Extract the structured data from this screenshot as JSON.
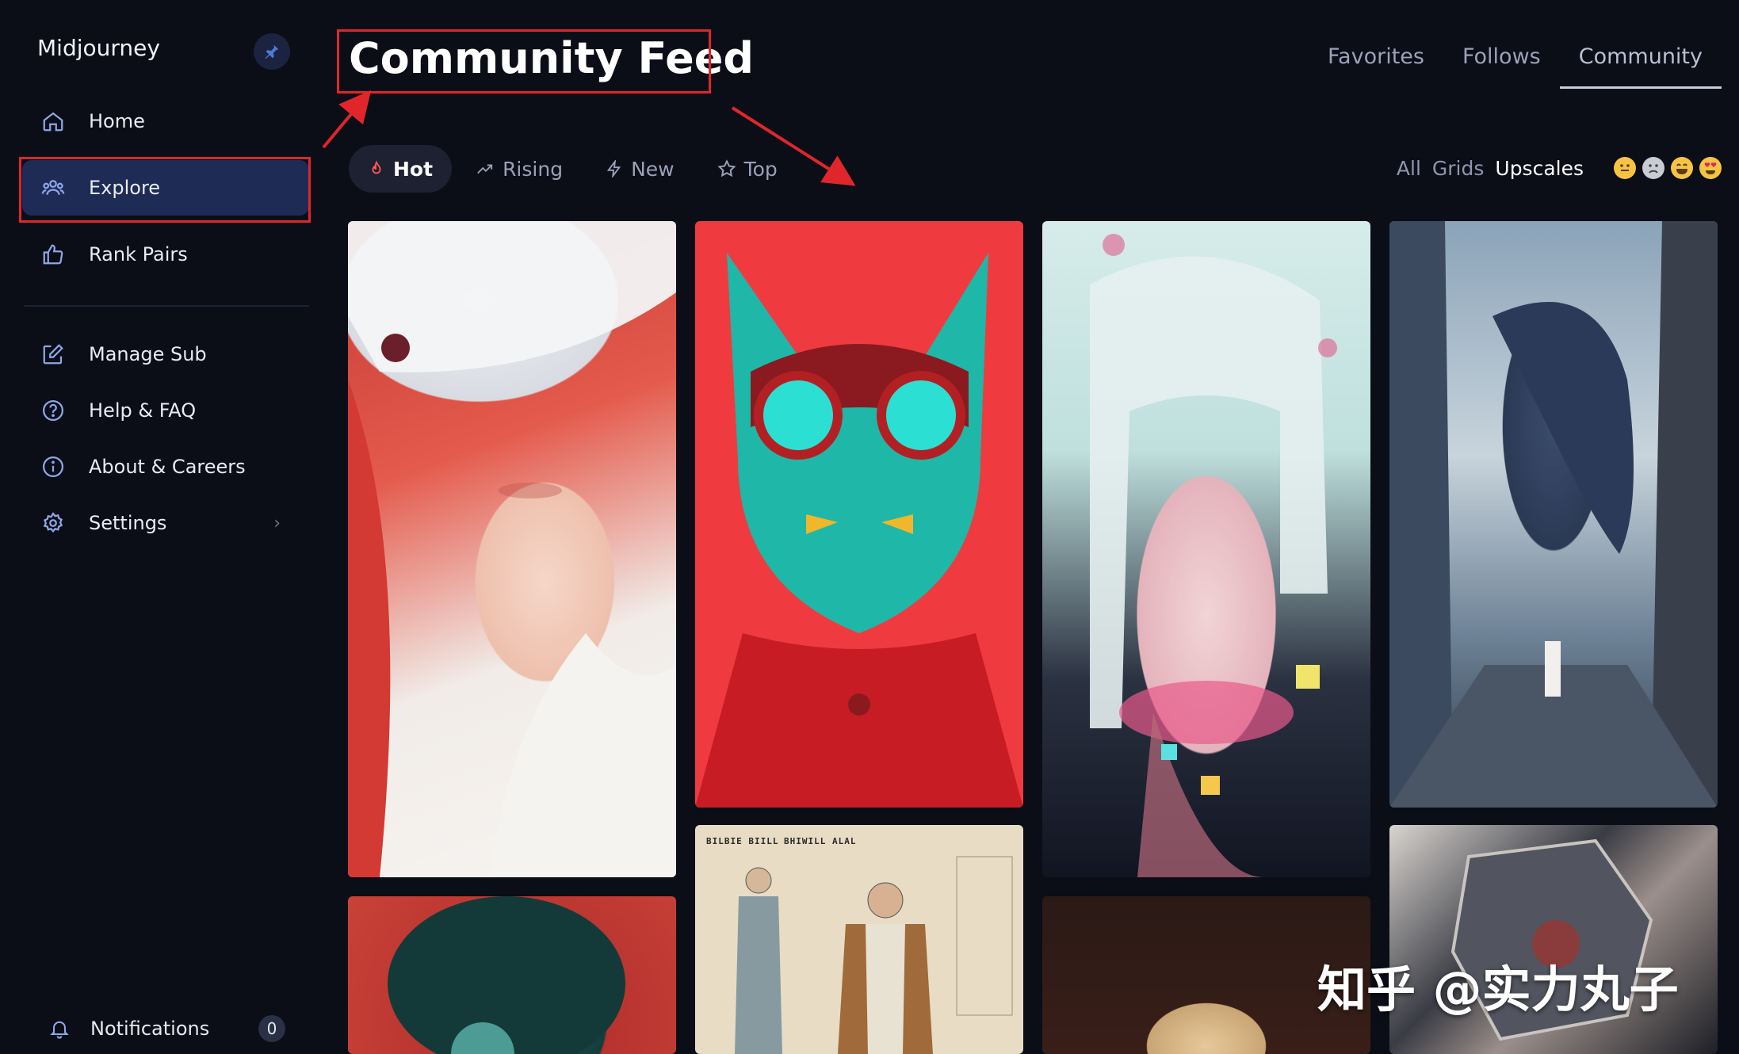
{
  "sidebar": {
    "brand": "Midjourney",
    "items": [
      {
        "label": "Home",
        "icon": "home-icon"
      },
      {
        "label": "Explore",
        "icon": "users-icon"
      },
      {
        "label": "Rank Pairs",
        "icon": "thumbs-up-icon"
      },
      {
        "label": "Manage Sub",
        "icon": "edit-icon"
      },
      {
        "label": "Help & FAQ",
        "icon": "help-icon"
      },
      {
        "label": "About & Careers",
        "icon": "info-icon"
      },
      {
        "label": "Settings",
        "icon": "gear-icon"
      }
    ],
    "active_item": "Explore",
    "notifications": {
      "label": "Notifications",
      "count": "0"
    }
  },
  "header": {
    "title": "Community Feed",
    "tabs": [
      "Favorites",
      "Follows",
      "Community"
    ],
    "active_tab": "Community"
  },
  "sort_tabs": [
    "Hot",
    "Rising",
    "New",
    "Top"
  ],
  "active_sort": "Hot",
  "filters": [
    "All",
    "Grids",
    "Upscales"
  ],
  "active_filter": "Upscales",
  "reactions": [
    "slightly-smiling-face",
    "crying-face",
    "grinning-face",
    "heart-eyes-face"
  ],
  "gallery": {
    "sketch_headers": [
      "BILBIE BIILL",
      "BHIWILL ALAL"
    ]
  },
  "watermark": "知乎 @实力丸子",
  "colors": {
    "background": "#0b0d17",
    "active_nav": "#1e2b55",
    "highlight_box": "#e0262a",
    "annotation_arrow": "#e0262a"
  }
}
